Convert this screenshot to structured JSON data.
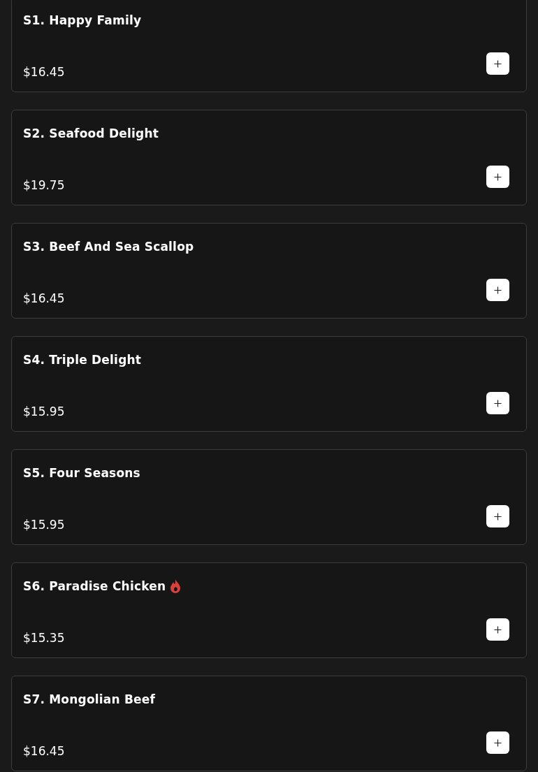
{
  "items": [
    {
      "name": "S1. Happy Family",
      "price": "$16.45",
      "spicy": false
    },
    {
      "name": "S2. Seafood Delight",
      "price": "$19.75",
      "spicy": false
    },
    {
      "name": "S3. Beef And Sea Scallop",
      "price": "$16.45",
      "spicy": false
    },
    {
      "name": "S4. Triple Delight",
      "price": "$15.95",
      "spicy": false
    },
    {
      "name": "S5. Four Seasons",
      "price": "$15.95",
      "spicy": false
    },
    {
      "name": "S6. Paradise Chicken",
      "price": "$15.35",
      "spicy": true
    },
    {
      "name": "S7. Mongolian Beef",
      "price": "$16.45",
      "spicy": false
    }
  ]
}
